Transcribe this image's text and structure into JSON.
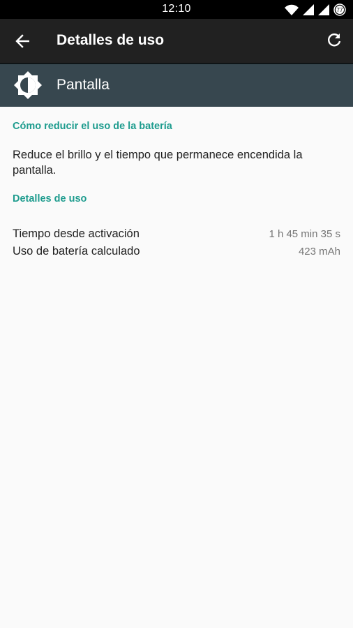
{
  "status_bar": {
    "time": "12:10",
    "battery_level": "77",
    "icons": [
      "wifi-icon",
      "signal-icon",
      "signal-icon",
      "battery-icon"
    ]
  },
  "app_bar": {
    "title": "Detalles de uso",
    "back_icon": "arrow-back-icon",
    "refresh_icon": "refresh-icon"
  },
  "header": {
    "title": "Pantalla",
    "icon": "brightness-icon"
  },
  "tips": {
    "title": "Cómo reducir el uso de la batería",
    "text": "Reduce el brillo y el tiempo que permanece encendida la pantalla."
  },
  "usage": {
    "title": "Detalles de uso",
    "rows": [
      {
        "label": "Tiempo desde activación",
        "value": "1 h 45 min 35 s"
      },
      {
        "label": "Uso de batería calculado",
        "value": "423 mAh"
      }
    ]
  },
  "colors": {
    "status_bar": "#000000",
    "app_bar": "#212121",
    "header": "#37474f",
    "accent": "#1e9c8e",
    "background": "#fafafa"
  }
}
